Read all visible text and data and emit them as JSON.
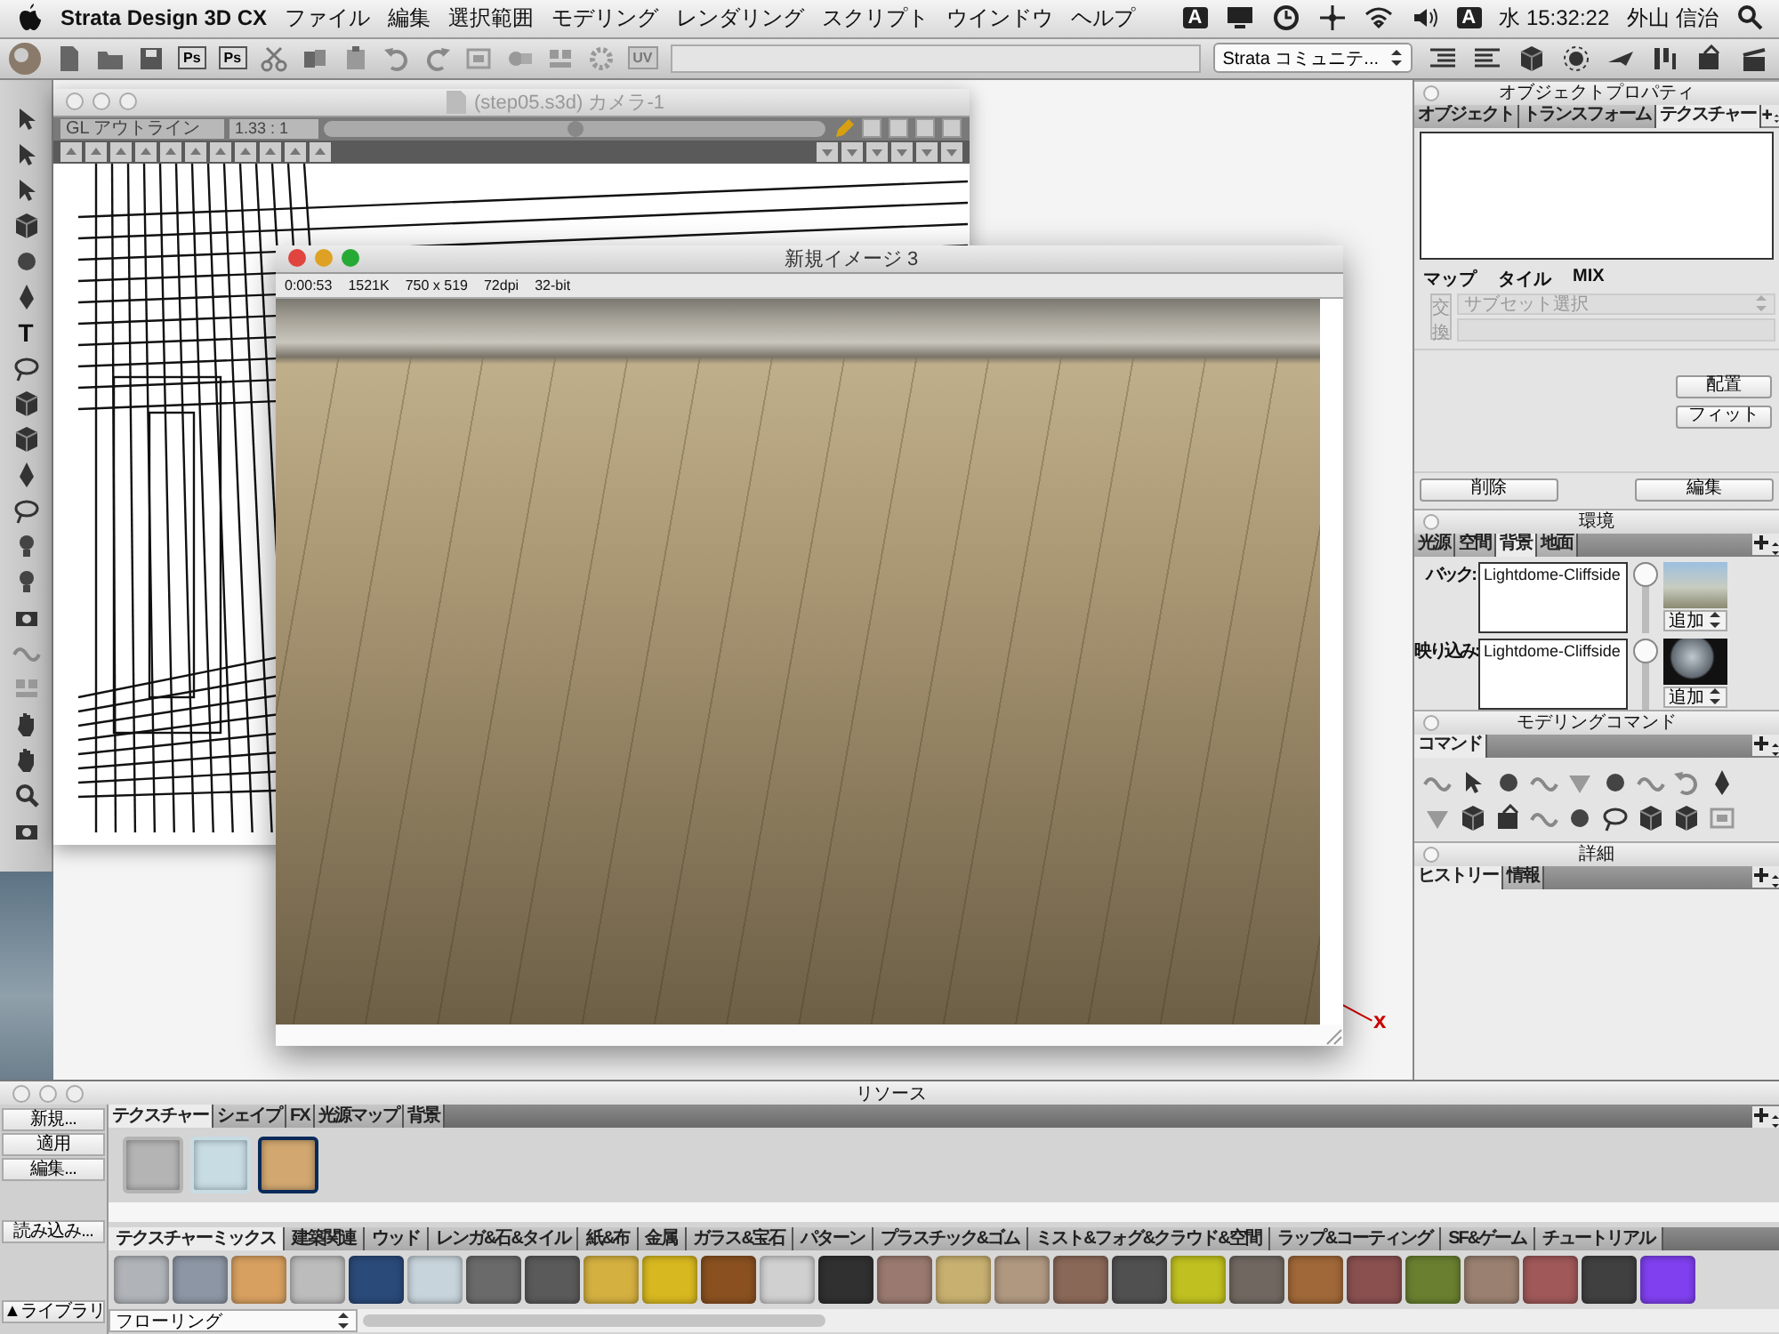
{
  "menu_bar": {
    "app_name": "Strata Design 3D CX",
    "menus": [
      "ファイル",
      "編集",
      "選択範囲",
      "モデリング",
      "レンダリング",
      "スクリプト",
      "ウインドウ",
      "ヘルプ"
    ],
    "input_badges": [
      "A",
      "A"
    ],
    "clock": "水 15:32:22",
    "user": "外山 信治"
  },
  "toolbar": {
    "ps_buttons": [
      "Ps",
      "Ps"
    ],
    "uv_button": "UV",
    "community_dropdown": "Strata コミュニテ..."
  },
  "tool_palette": {
    "text_tool": "T"
  },
  "model_window": {
    "title": "(step05.s3d) カメラ-1",
    "display_mode": "GL アウトライン",
    "aspect_ratio": "1.33 : 1",
    "zoom_slider": {
      "level": 0.5
    },
    "axis_label": "x"
  },
  "render_window": {
    "title": "新規イメージ 3",
    "info": [
      "0:00:53",
      "1521K",
      "750 x 519",
      "72dpi",
      "32-bit"
    ]
  },
  "object_properties": {
    "title": "オブジェクトプロパティ",
    "tabs": [
      {
        "label": "オブジェクト",
        "selected": false
      },
      {
        "label": "トランスフォーム",
        "selected": false
      },
      {
        "label": "テクスチャー",
        "selected": true
      }
    ],
    "labels": [
      "マップ",
      "タイル",
      "MIX"
    ],
    "swap_button": "交換",
    "subset_dropdown": "サブセット選択",
    "side_buttons": [
      "配置",
      "フィット"
    ],
    "bottom_buttons": [
      "削除",
      "編集"
    ]
  },
  "environment": {
    "title": "環境",
    "tabs": [
      {
        "label": "光源",
        "selected": false
      },
      {
        "label": "空間",
        "selected": false
      },
      {
        "label": "背景",
        "selected": true
      },
      {
        "label": "地面",
        "selected": false
      }
    ],
    "slots": [
      {
        "kind": "photo",
        "label": "バック:",
        "value": "Lightdome-Cliffside",
        "level": 1,
        "add": "追加"
      },
      {
        "kind": "sphere",
        "label": "映り込み:",
        "value": "Lightdome-Cliffside",
        "level": 1,
        "add": "追加"
      }
    ]
  },
  "modeling_commands": {
    "title": "モデリングコマンド",
    "tabs": [
      {
        "label": "コマンド",
        "selected": true
      }
    ]
  },
  "details": {
    "title": "詳細",
    "tabs": [
      {
        "label": "ヒストリー",
        "selected": true
      },
      {
        "label": "情報",
        "selected": false
      }
    ]
  },
  "resources": {
    "title": "リソース",
    "side_buttons": [
      "新規...",
      "適用",
      "編集..."
    ],
    "load_button": "読み込み...",
    "library_button": "▲ライブラリ",
    "tabs": [
      {
        "label": "テクスチャー",
        "selected": true
      },
      {
        "label": "シェイプ",
        "selected": false
      },
      {
        "label": "FX",
        "selected": false
      },
      {
        "label": "光源マップ",
        "selected": false
      },
      {
        "label": "背景",
        "selected": false
      }
    ],
    "items": [
      {
        "color": "#b4b4b4",
        "selected": false
      },
      {
        "color": "#c8dce4",
        "selected": false
      },
      {
        "color": "#d2a870",
        "selected": true
      }
    ],
    "library_tabs": [
      {
        "label": "テクスチャーミックス",
        "selected": true
      },
      {
        "label": "建築関連",
        "selected": false
      },
      {
        "label": "ウッド",
        "selected": false
      },
      {
        "label": "レンガ&石&タイル",
        "selected": false
      },
      {
        "label": "紙&布",
        "selected": false
      },
      {
        "label": "金属",
        "selected": false
      },
      {
        "label": "ガラス&宝石",
        "selected": false
      },
      {
        "label": "パターン",
        "selected": false
      },
      {
        "label": "プラスチック&ゴム",
        "selected": false
      },
      {
        "label": "ミスト&フォグ&クラウド&空間",
        "selected": false
      },
      {
        "label": "ラップ&コーティング",
        "selected": false
      },
      {
        "label": "SF&ゲーム",
        "selected": false
      },
      {
        "label": "チュートリアル",
        "selected": false
      }
    ],
    "swatches": [
      {
        "color": "#b0b4b8"
      },
      {
        "color": "#8c96a4"
      },
      {
        "color": "#d8a060"
      },
      {
        "color": "#bcbcbc"
      },
      {
        "color": "#2a4a7a"
      },
      {
        "color": "#c8d4dc"
      },
      {
        "color": "#6a6a6a"
      },
      {
        "color": "#5a5a5a"
      },
      {
        "color": "#d4b040"
      },
      {
        "color": "#d8b820"
      },
      {
        "color": "#8a5020"
      },
      {
        "color": "#d0d0d0"
      },
      {
        "color": "#303030"
      },
      {
        "color": "#9a7a70"
      },
      {
        "color": "#c8b070"
      },
      {
        "color": "#b09880"
      },
      {
        "color": "#8a6858"
      },
      {
        "color": "#505050"
      },
      {
        "color": "#c0c020"
      },
      {
        "color": "#706860"
      },
      {
        "color": "#a06838"
      },
      {
        "color": "#8a5050"
      },
      {
        "color": "#6a8030"
      },
      {
        "color": "#9a8070"
      },
      {
        "color": "#a05858"
      },
      {
        "color": "#404040"
      },
      {
        "color": "#8040f0"
      }
    ],
    "category_dropdown": "フローリング"
  }
}
